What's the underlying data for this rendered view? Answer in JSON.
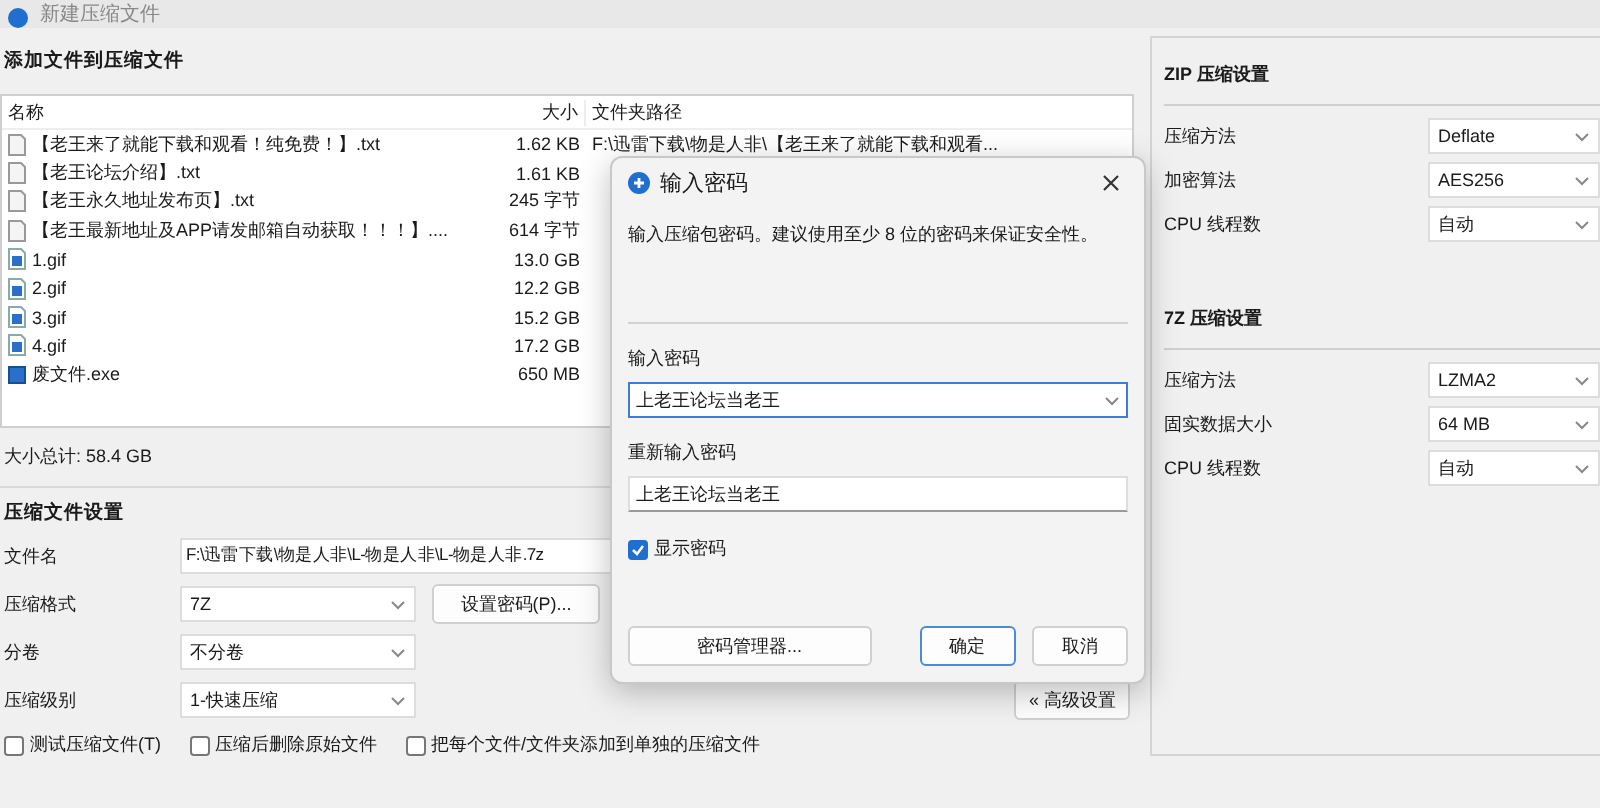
{
  "window": {
    "title": "新建压缩文件"
  },
  "add_section": {
    "title": "添加文件到压缩文件"
  },
  "file_list": {
    "columns": [
      "名称",
      "大小",
      "文件夹路径"
    ],
    "rows": [
      {
        "kind": "text",
        "name": "【老王来了就能下载和观看！纯免费！】.txt",
        "size": "1.62 KB",
        "path": "F:\\迅雷下载\\物是人非\\【老王来了就能下载和观看..."
      },
      {
        "kind": "text",
        "name": "【老王论坛介绍】.txt",
        "size": "1.61 KB"
      },
      {
        "kind": "text",
        "name": "【老王永久地址发布页】.txt",
        "size": "245 字节"
      },
      {
        "kind": "text",
        "name": "【老王最新地址及APP请发邮箱自动获取！！！】....",
        "size": "614 字节"
      },
      {
        "kind": "image",
        "name": "1.gif",
        "size": "13.0 GB"
      },
      {
        "kind": "image",
        "name": "2.gif",
        "size": "12.2 GB"
      },
      {
        "kind": "image",
        "name": "3.gif",
        "size": "15.2 GB"
      },
      {
        "kind": "image",
        "name": "4.gif",
        "size": "17.2 GB"
      },
      {
        "kind": "program",
        "name": "废文件.exe",
        "size": "650 MB"
      }
    ]
  },
  "total": "大小总计: 58.4 GB",
  "archive_settings": {
    "title": "压缩文件设置",
    "filename": {
      "label": "文件名",
      "value": "F:\\迅雷下载\\物是人非\\L-物是人非\\L-物是人非.7z"
    },
    "format": {
      "label": "压缩格式",
      "value": "7Z"
    },
    "password_button": "设置密码(P)...",
    "split": {
      "label": "分卷",
      "value": "不分卷"
    },
    "level": {
      "label": "压缩级别",
      "value": "1-快速压缩"
    },
    "advanced_button": "« 高级设置",
    "options": [
      {
        "label": "测试压缩文件(T)",
        "checked": false
      },
      {
        "label": "压缩后删除原始文件",
        "checked": false
      },
      {
        "label": "把每个文件/文件夹添加到单独的压缩文件",
        "checked": false
      }
    ]
  },
  "side_groups": [
    {
      "title": "ZIP 压缩设置",
      "rows": [
        {
          "label": "压缩方法",
          "value": "Deflate"
        },
        {
          "label": "加密算法",
          "value": "AES256"
        },
        {
          "label": "CPU 线程数",
          "value": "自动"
        }
      ]
    },
    {
      "title": "7Z 压缩设置",
      "rows": [
        {
          "label": "压缩方法",
          "value": "LZMA2"
        },
        {
          "label": "固实数据大小",
          "value": "64 MB"
        },
        {
          "label": "CPU 线程数",
          "value": "自动"
        }
      ]
    }
  ],
  "dialog": {
    "title": "输入密码",
    "description": "输入压缩包密码。建议使用至少 8 位的密码来保证安全性。",
    "password": {
      "label": "输入密码",
      "value": "上老王论坛当老王"
    },
    "confirm": {
      "label": "重新输入密码",
      "value": "上老王论坛当老王"
    },
    "show_password": {
      "label": "显示密码",
      "checked": true
    },
    "buttons": [
      {
        "label": "密码管理器...",
        "default": false
      },
      {
        "label": "确定",
        "default": true
      },
      {
        "label": "取消",
        "default": false
      }
    ]
  }
}
